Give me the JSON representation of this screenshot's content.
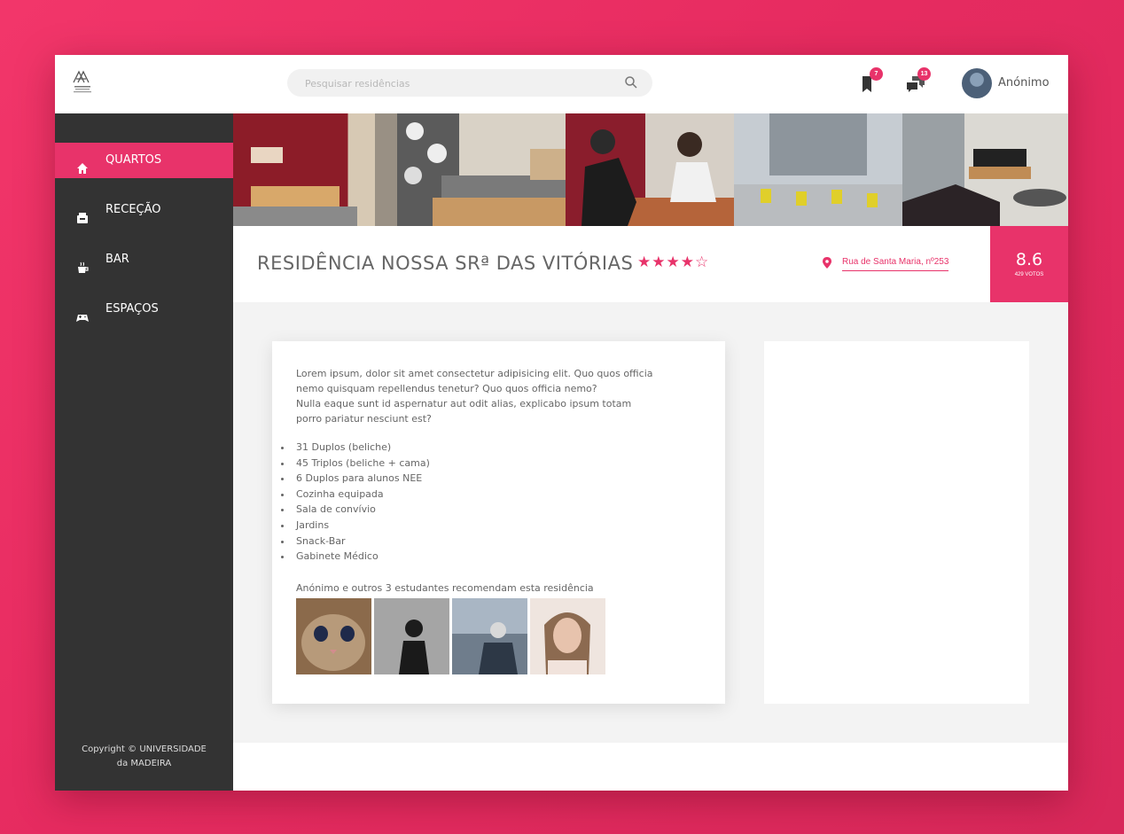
{
  "topbar": {
    "search_placeholder": "Pesquisar residências",
    "bookmarks_count": "7",
    "messages_count": "13",
    "username": "Anónimo"
  },
  "sidebar": {
    "items": [
      {
        "label": "QUARTOS",
        "icon": "home-icon",
        "active": true
      },
      {
        "label": "RECEÇÃO",
        "icon": "reception-icon",
        "active": false
      },
      {
        "label": "BAR",
        "icon": "coffee-icon",
        "active": false
      },
      {
        "label": "ESPAÇOS",
        "icon": "gamepad-icon",
        "active": false
      }
    ],
    "copyright_line1": "Copyright © UNIVERSIDADE",
    "copyright_line2": "da MADEIRA"
  },
  "residence": {
    "title": "RESIDÊNCIA NOSSA SRª DAS VITÓRIAS",
    "stars": "★★★★☆",
    "rating": 4,
    "address": "Rua de Santa Maria, nº253",
    "score": "8.6",
    "votes": "429 VOTOS"
  },
  "content": {
    "description_lines": [
      "Lorem ipsum, dolor sit amet consectetur adipisicing elit. Quo quos officia",
      "nemo quisquam repellendus tenetur? Quo quos officia nemo?",
      "Nulla eaque sunt id aspernatur aut odit alias, explicabo ipsum totam",
      "porro pariatur nesciunt est?"
    ],
    "features": [
      "31 Duplos (beliche)",
      "45 Triplos (beliche + cama)",
      "6 Duplos para alunos NEE",
      "Cozinha equipada",
      "Sala de convívio",
      "Jardins",
      "Snack-Bar",
      "Gabinete Médico"
    ],
    "recommend_text": "Anónimo e outros 3 estudantes recomendam esta residência"
  },
  "colors": {
    "accent": "#e8336a",
    "sidebar": "#333333",
    "background": "#f3f3f3"
  }
}
